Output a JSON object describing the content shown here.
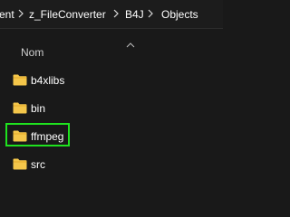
{
  "breadcrumb": {
    "items": [
      {
        "label": "ent"
      },
      {
        "label": "z_FileConverter"
      },
      {
        "label": "B4J"
      },
      {
        "label": "Objects"
      }
    ],
    "separator_icon": "chevron-right-icon"
  },
  "list": {
    "sort_icon": "sort-ascending-icon",
    "column_header": "Nom",
    "items": [
      {
        "name": "b4xlibs",
        "icon": "folder-icon"
      },
      {
        "name": "bin",
        "icon": "folder-icon"
      },
      {
        "name": "ffmpeg",
        "icon": "folder-icon",
        "highlighted": true
      },
      {
        "name": "src",
        "icon": "folder-icon"
      }
    ]
  },
  "colors": {
    "background": "#191919",
    "folder": "#f4c64a",
    "highlight": "#1fe21f",
    "text": "#ffffff"
  }
}
